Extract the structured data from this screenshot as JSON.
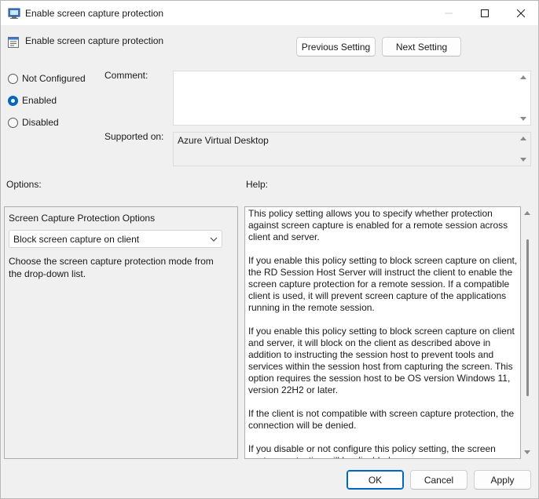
{
  "window": {
    "title": "Enable screen capture protection"
  },
  "header": {
    "title": "Enable screen capture protection"
  },
  "nav": {
    "previous_label": "Previous Setting",
    "next_label": "Next Setting"
  },
  "state": {
    "options": [
      {
        "label": "Not Configured",
        "checked": false
      },
      {
        "label": "Enabled",
        "checked": true
      },
      {
        "label": "Disabled",
        "checked": false
      }
    ]
  },
  "comment": {
    "label": "Comment:",
    "value": ""
  },
  "supported": {
    "label": "Supported on:",
    "value": "Azure Virtual Desktop"
  },
  "options": {
    "label": "Options:",
    "title": "Screen Capture Protection Options",
    "selected": "Block screen capture on client",
    "description": "Choose the screen capture protection mode from the drop-down list."
  },
  "help": {
    "label": "Help:",
    "paragraphs": [
      "This policy setting allows you to specify whether protection against screen capture is enabled for a remote session across client and server.",
      "If you enable this policy setting to block screen capture on client, the RD Session Host Server will instruct the client to enable the screen capture protection for a remote session. If a compatible client is used, it will prevent screen capture of the applications running in the remote session.",
      "If you enable this policy setting to block screen capture on client and server, it will block on the client as described above in addition to instructing the session host to prevent tools and services within the session host from capturing the screen. This option requires the session host to be OS version Windows 11, version 22H2 or later.",
      "If the client is not compatible with screen capture protection, the connection will be denied.",
      "If you disable or not configure this policy setting, the screen capture protection will be disabled."
    ]
  },
  "footer": {
    "ok_label": "OK",
    "cancel_label": "Cancel",
    "apply_label": "Apply"
  },
  "colors": {
    "accent": "#0067c0"
  }
}
